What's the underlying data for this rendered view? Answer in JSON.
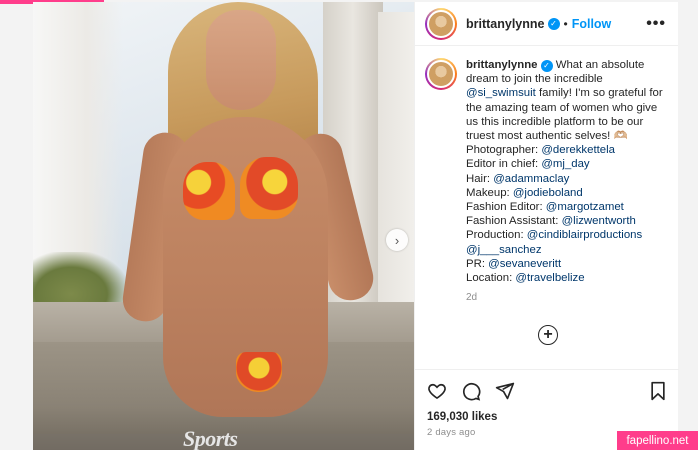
{
  "post": {
    "username": "brittanylynne",
    "follow_label": "Follow",
    "separator": "•",
    "more_icon": "more-horizontal-icon",
    "media": {
      "magazine_title": "Sports",
      "next_icon": "chevron-right-icon"
    },
    "caption": {
      "username": "brittanylynne",
      "intro_1": " What an absolute dream to join the incredible ",
      "mention_si": "@si_swimsuit",
      "intro_2": " family! I'm so grateful for the amazing team of women who give us this incredible platform to be our truest most authentic selves! 🫶🏼",
      "credits": [
        {
          "label": "Photographer: ",
          "handle": "@derekkettela"
        },
        {
          "label": "Editor in chief: ",
          "handle": "@mj_day"
        },
        {
          "label": "Hair: ",
          "handle": "@adammaclay"
        },
        {
          "label": "Makeup: ",
          "handle": "@jodieboland"
        },
        {
          "label": "Fashion Editor: ",
          "handle": "@margotzamet"
        },
        {
          "label": "Fashion Assistant: ",
          "handle": "@lizwentworth"
        },
        {
          "label": "Production: ",
          "handle": "@cindiblairproductions"
        },
        {
          "label": "",
          "handle": "@j___sanchez"
        },
        {
          "label": "PR: ",
          "handle": "@sevaneveritt"
        },
        {
          "label": "Location: ",
          "handle": "@travelbelize"
        }
      ],
      "time": "2d"
    },
    "load_more_icon": "plus-circle-icon",
    "likes": "169,030 likes",
    "posted_ago": "2 days ago"
  },
  "watermark": "fapellino.net",
  "colors": {
    "accent_pink": "#ff3d8b",
    "link_blue": "#0095f6",
    "mention_blue": "#00376b"
  }
}
